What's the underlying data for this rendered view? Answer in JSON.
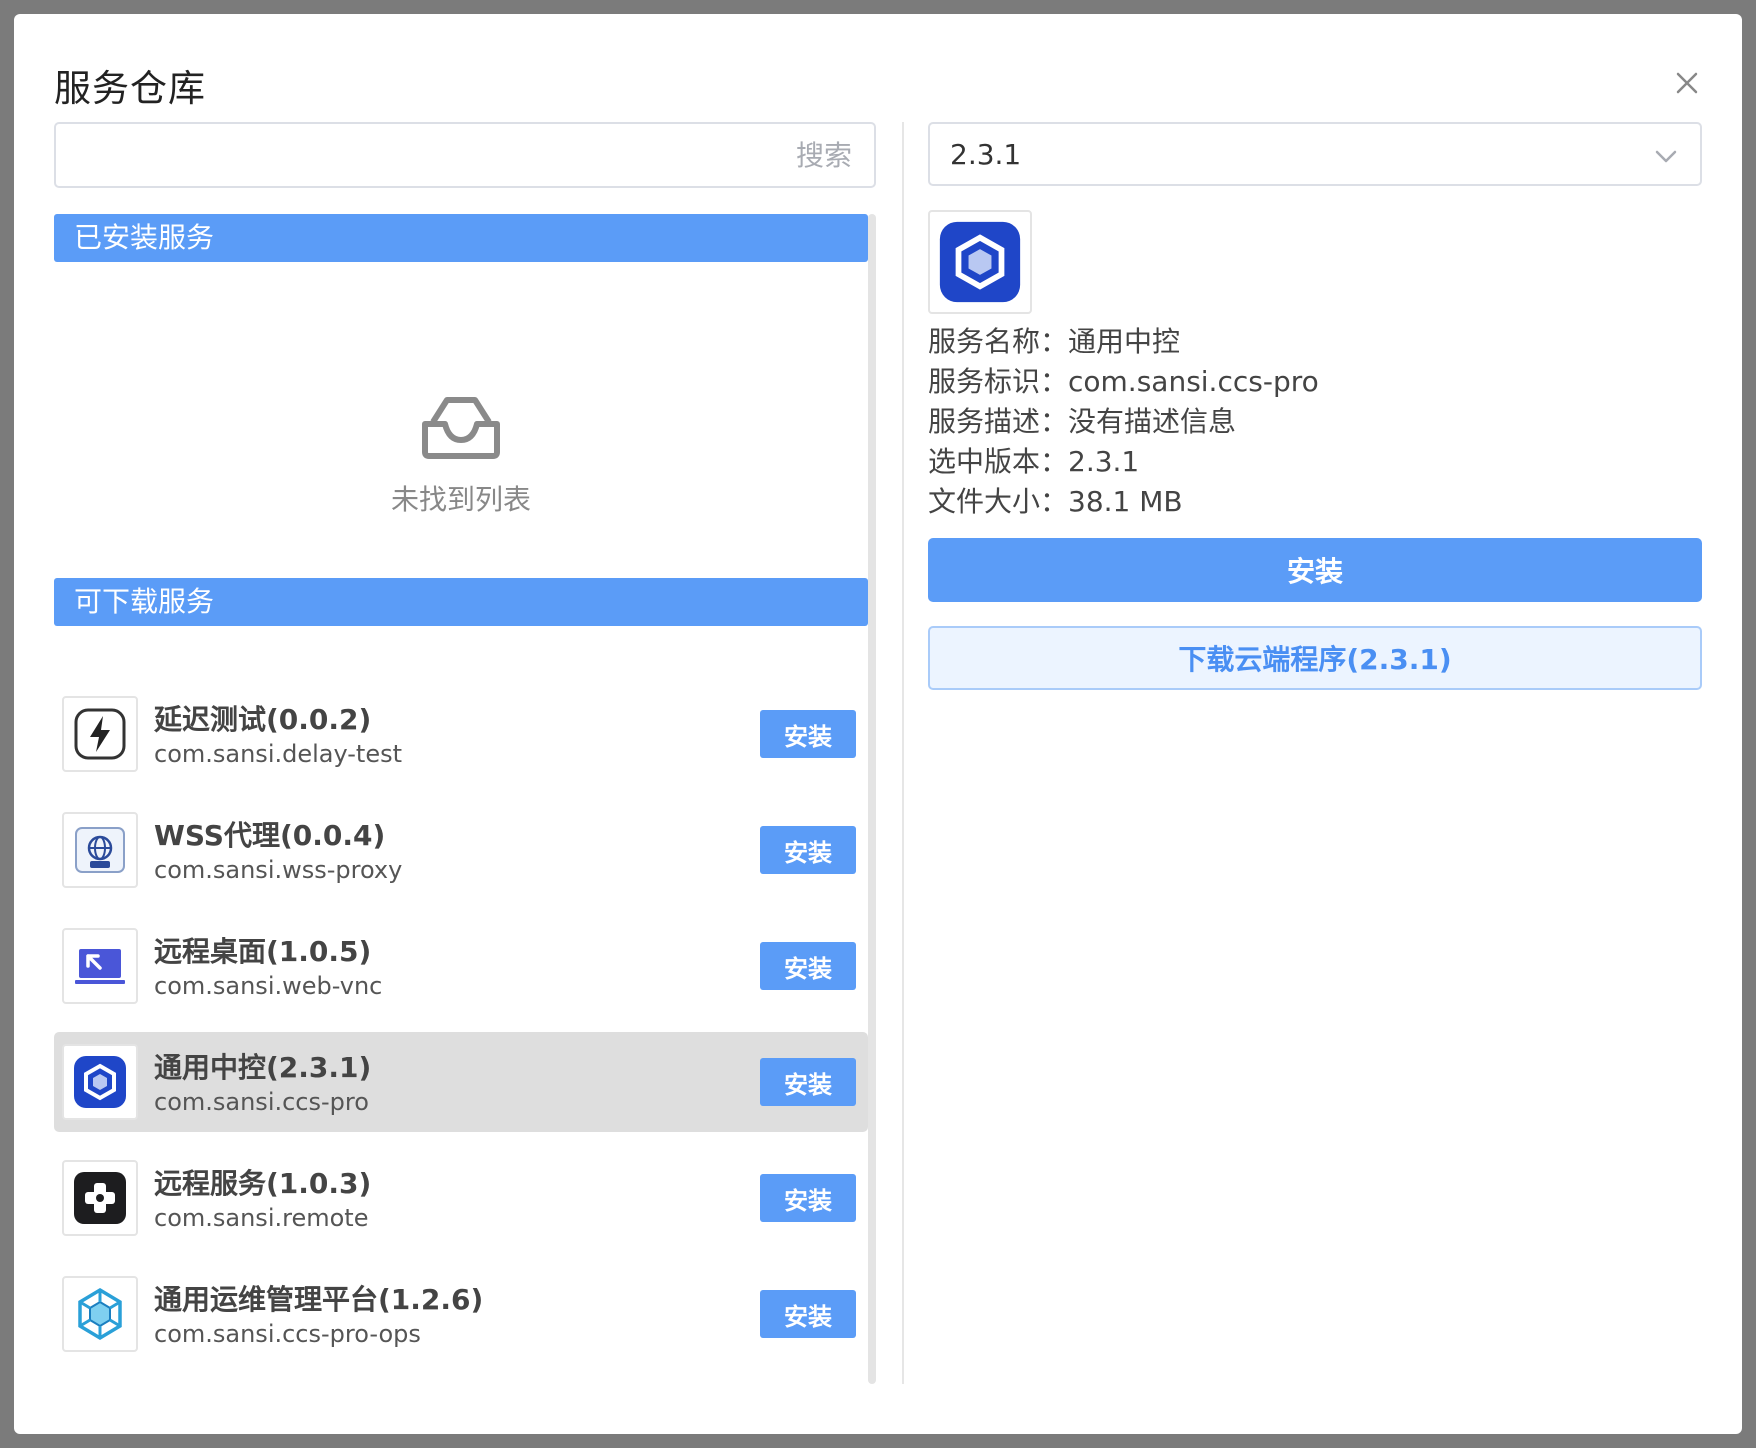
{
  "dialog": {
    "title": "服务仓库"
  },
  "search": {
    "placeholder": "搜索",
    "value": ""
  },
  "installed": {
    "header": "已安装服务",
    "empty_text": "未找到列表"
  },
  "available": {
    "header": "可下载服务",
    "install_label": "安装",
    "items": [
      {
        "name": "延迟测试(0.0.2)",
        "id": "com.sansi.delay-test",
        "icon": "lightning-icon"
      },
      {
        "name": "WSS代理(0.0.4)",
        "id": "com.sansi.wss-proxy",
        "icon": "globe-icon"
      },
      {
        "name": "远程桌面(1.0.5)",
        "id": "com.sansi.web-vnc",
        "icon": "laptop-icon"
      },
      {
        "name": "通用中控(2.3.1)",
        "id": "com.sansi.ccs-pro",
        "icon": "hexagon-cube-icon",
        "selected": true
      },
      {
        "name": "远程服务(1.0.3)",
        "id": "com.sansi.remote",
        "icon": "gamepad-icon"
      },
      {
        "name": "通用运维管理平台(1.2.6)",
        "id": "com.sansi.ccs-pro-ops",
        "icon": "cube-network-icon"
      }
    ]
  },
  "detail": {
    "version": "2.3.1",
    "lines": {
      "name": "服务名称：通用中控",
      "id": "服务标识：com.sansi.ccs-pro",
      "desc": "服务描述：没有描述信息",
      "version": "选中版本：2.3.1",
      "size": "文件大小：38.1 MB"
    },
    "install_label": "安装",
    "download_label": "下载云端程序(2.3.1)"
  },
  "colors": {
    "accent": "#5b9cf7",
    "selected_row": "#dedede",
    "backdrop": "#7b7b7b"
  }
}
